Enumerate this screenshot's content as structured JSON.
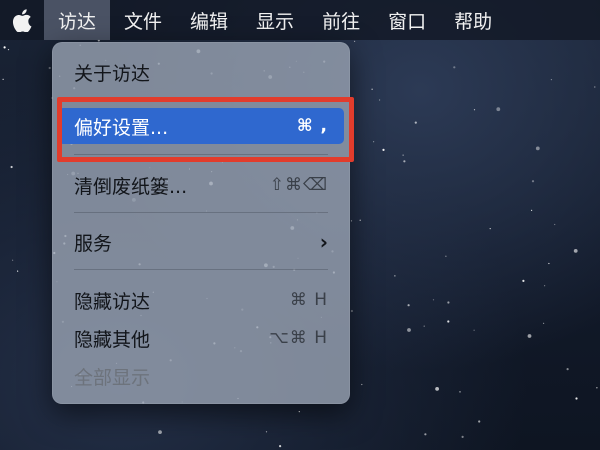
{
  "menubar": {
    "apple_icon": "apple-logo-icon",
    "items": [
      "访达",
      "文件",
      "编辑",
      "显示",
      "前往",
      "窗口",
      "帮助"
    ]
  },
  "dropdown": {
    "about": "关于访达",
    "preferences": {
      "label": "偏好设置...",
      "shortcut": "⌘ ,"
    },
    "empty_trash": {
      "label": "清倒废纸篓...",
      "shortcut": "⇧⌘⌫"
    },
    "services": {
      "label": "服务",
      "submenu_icon": "chevron-right-icon"
    },
    "hide_finder": {
      "label": "隐藏访达",
      "shortcut": "⌘ H"
    },
    "hide_others": {
      "label": "隐藏其他",
      "shortcut": "⌥⌘ H"
    },
    "show_all": "全部显示"
  },
  "colors": {
    "highlight_border": "#e23c2c",
    "selection": "#2f68cf"
  }
}
